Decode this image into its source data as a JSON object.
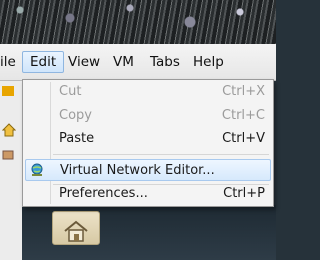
{
  "menubar": {
    "items": [
      {
        "label": "ile"
      },
      {
        "label": "Edit"
      },
      {
        "label": "View"
      },
      {
        "label": "VM"
      },
      {
        "label": "Tabs"
      },
      {
        "label": "Help"
      }
    ]
  },
  "edit_menu": {
    "items": [
      {
        "label": "Cut",
        "shortcut": "Ctrl+X",
        "enabled": false
      },
      {
        "label": "Copy",
        "shortcut": "Ctrl+C",
        "enabled": false
      },
      {
        "label": "Paste",
        "shortcut": "Ctrl+V",
        "enabled": true
      },
      {
        "label": "Virtual Network Editor...",
        "shortcut": "",
        "enabled": true,
        "icon": "network-globe-icon",
        "highlighted": true
      },
      {
        "label": "Preferences...",
        "shortcut": "Ctrl+P",
        "enabled": true
      }
    ]
  },
  "colors": {
    "menu_bg": "#f4f4f4",
    "highlight": "#d6e9fc",
    "disabled_text": "#9b9b9b",
    "desktop": "#26323a"
  }
}
